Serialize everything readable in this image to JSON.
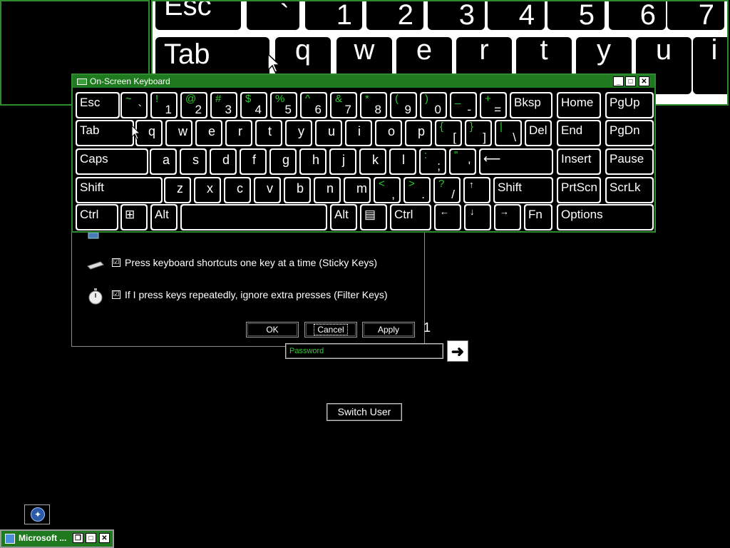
{
  "magnifier": {
    "row1": [
      {
        "main": "Esc",
        "shift": ""
      },
      {
        "main": "`",
        "shift": "~"
      },
      {
        "main": "1",
        "shift": "!"
      },
      {
        "main": "2",
        "shift": "@"
      },
      {
        "main": "3",
        "shift": "#"
      },
      {
        "main": "4",
        "shift": "$"
      },
      {
        "main": "5",
        "shift": "%"
      },
      {
        "main": "6",
        "shift": "^"
      },
      {
        "main": "7",
        "shift": "&"
      }
    ],
    "row2": [
      "Tab",
      "q",
      "w",
      "e",
      "r",
      "t",
      "y",
      "u",
      "i"
    ]
  },
  "osk": {
    "title": "On-Screen Keyboard",
    "controls": {
      "minimize": "_",
      "restore": "□",
      "close": "✕"
    },
    "row1": [
      {
        "label": "Esc"
      },
      {
        "shift": "~",
        "base": "`"
      },
      {
        "shift": "!",
        "base": "1"
      },
      {
        "shift": "@",
        "base": "2"
      },
      {
        "shift": "#",
        "base": "3"
      },
      {
        "shift": "$",
        "base": "4"
      },
      {
        "shift": "%",
        "base": "5"
      },
      {
        "shift": "^",
        "base": "6"
      },
      {
        "shift": "&",
        "base": "7"
      },
      {
        "shift": "*",
        "base": "8"
      },
      {
        "shift": "(",
        "base": "9"
      },
      {
        "shift": ")",
        "base": "0"
      },
      {
        "shift": "_",
        "base": "-"
      },
      {
        "shift": "+",
        "base": "="
      },
      {
        "label": "Bksp"
      },
      {
        "label": "Home"
      },
      {
        "label": "PgUp"
      }
    ],
    "row2": [
      {
        "label": "Tab"
      },
      {
        "letter": "q"
      },
      {
        "letter": "w"
      },
      {
        "letter": "e"
      },
      {
        "letter": "r"
      },
      {
        "letter": "t"
      },
      {
        "letter": "y"
      },
      {
        "letter": "u"
      },
      {
        "letter": "i"
      },
      {
        "letter": "o"
      },
      {
        "letter": "p"
      },
      {
        "shift": "{",
        "base": "["
      },
      {
        "shift": "}",
        "base": "]"
      },
      {
        "shift": "|",
        "base": "\\"
      },
      {
        "label": "Del"
      },
      {
        "label": "End"
      },
      {
        "label": "PgDn"
      }
    ],
    "row3": [
      {
        "label": "Caps"
      },
      {
        "letter": "a"
      },
      {
        "letter": "s"
      },
      {
        "letter": "d"
      },
      {
        "letter": "f"
      },
      {
        "letter": "g"
      },
      {
        "letter": "h"
      },
      {
        "letter": "j"
      },
      {
        "letter": "k"
      },
      {
        "letter": "l"
      },
      {
        "shift": ":",
        "base": ";"
      },
      {
        "shift": "\"",
        "base": "'"
      },
      {
        "label": "⟵"
      },
      {
        "label": "Insert"
      },
      {
        "label": "Pause"
      }
    ],
    "row4": [
      {
        "label": "Shift"
      },
      {
        "letter": "z"
      },
      {
        "letter": "x"
      },
      {
        "letter": "c"
      },
      {
        "letter": "v"
      },
      {
        "letter": "b"
      },
      {
        "letter": "n"
      },
      {
        "letter": "m"
      },
      {
        "shift": "<",
        "base": ","
      },
      {
        "shift": ">",
        "base": "."
      },
      {
        "shift": "?",
        "base": "/"
      },
      {
        "label": "↑"
      },
      {
        "label": "Shift"
      },
      {
        "label": "PrtScn"
      },
      {
        "label": "ScrLk"
      }
    ],
    "row5": [
      {
        "label": "Ctrl"
      },
      {
        "label": "⊞"
      },
      {
        "label": "Alt"
      },
      {
        "label": ""
      },
      {
        "label": "Alt"
      },
      {
        "label": "▤"
      },
      {
        "label": "Ctrl"
      },
      {
        "label": "←"
      },
      {
        "label": "↓"
      },
      {
        "label": "→"
      },
      {
        "label": "Fn"
      },
      {
        "label": "Options"
      }
    ]
  },
  "ease_dialog": {
    "options": [
      {
        "label": "Press keyboard shortcuts one key at a time (Sticky Keys)",
        "checked": "☑"
      },
      {
        "label": "If I press keys repeatedly, ignore extra presses (Filter Keys)",
        "checked": "☑"
      }
    ],
    "buttons": {
      "ok": "OK",
      "cancel": "Cancel",
      "apply": "Apply"
    }
  },
  "logon": {
    "password_placeholder": "Password",
    "go_label": "➜",
    "switch_user": "Switch User",
    "partial_text": "1"
  },
  "taskbar": {
    "minimized_title": "Microsoft ...",
    "controls": {
      "restore": "❐",
      "maximize": "□",
      "close": "✕"
    }
  },
  "colors": {
    "accent_green": "#1f7a1f",
    "shift_green": "#2ecc2e"
  }
}
